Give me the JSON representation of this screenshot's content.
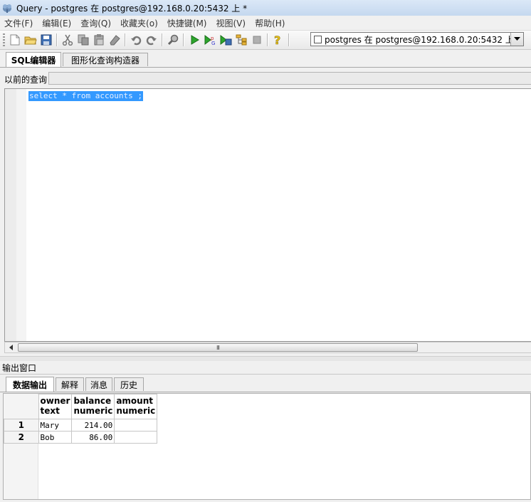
{
  "window": {
    "title": "Query - postgres 在  postgres@192.168.0.20:5432 上 *"
  },
  "menu": [
    "文件(F)",
    "编辑(E)",
    "查询(Q)",
    "收藏夹(o)",
    "快捷键(M)",
    "视图(V)",
    "帮助(H)"
  ],
  "toolbar": {
    "connection": "postgres 在  postgres@192.168.0.20:5432 上",
    "icons": [
      "new-file-icon",
      "open-folder-icon",
      "save-icon",
      "cut-icon",
      "copy-icon",
      "paste-icon",
      "clear-icon",
      "undo-icon",
      "redo-icon",
      "find-icon",
      "execute-icon",
      "explain-icon",
      "execute-file-icon",
      "explain-analyze-icon",
      "stop-icon",
      "help-icon"
    ]
  },
  "editor_tabs": [
    "SQL编辑器",
    "图形化查询构造器"
  ],
  "previous_queries_label": "以前的查询",
  "editor": {
    "sql": "select * from accounts ;"
  },
  "scrollbar_grip": "III",
  "output": {
    "header": "输出窗口",
    "tabs": [
      "数据输出",
      "解释",
      "消息",
      "历史"
    ],
    "columns": [
      {
        "name": "owner",
        "type": "text"
      },
      {
        "name": "balance",
        "type": "numeric"
      },
      {
        "name": "amount",
        "type": "numeric"
      }
    ],
    "rows": [
      {
        "num": "1",
        "owner": "Mary",
        "balance": "214.00",
        "amount": ""
      },
      {
        "num": "2",
        "owner": "Bob",
        "balance": "86.00",
        "amount": ""
      }
    ]
  }
}
